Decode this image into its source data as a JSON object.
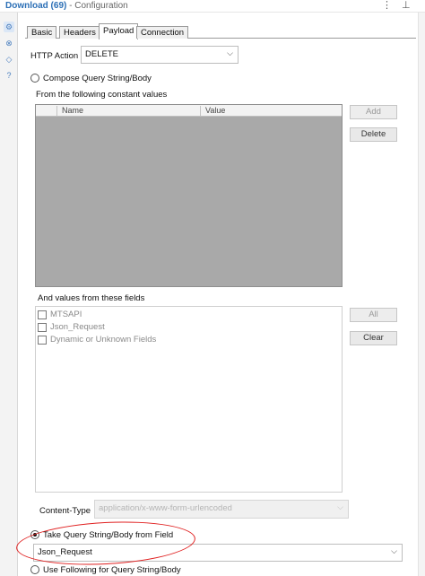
{
  "window": {
    "title": "Download (69)",
    "subtitle": "- Configuration"
  },
  "rail_icons": [
    "gear-icon",
    "close-circle-icon",
    "tag-icon",
    "help-icon"
  ],
  "tabs": [
    {
      "label": "Basic",
      "active": false
    },
    {
      "label": "Headers",
      "active": false
    },
    {
      "label": "Payload",
      "active": true
    },
    {
      "label": "Connection",
      "active": false
    }
  ],
  "http_action": {
    "label": "HTTP Action",
    "value": "DELETE"
  },
  "compose": {
    "radio_label": "Compose Query String/Body",
    "selected": false,
    "constants_label": "From the following constant values",
    "columns": [
      "Name",
      "Value"
    ],
    "buttons": {
      "add": "Add",
      "delete": "Delete"
    }
  },
  "fields": {
    "label": "And values from these fields",
    "items": [
      {
        "name": "MTSAPI",
        "checked": false
      },
      {
        "name": "Json_Request",
        "checked": false
      },
      {
        "name": "Dynamic or Unknown Fields",
        "checked": false
      }
    ],
    "buttons": {
      "all": "All",
      "clear": "Clear"
    }
  },
  "content_type": {
    "label": "Content-Type",
    "value": "application/x-www-form-urlencoded"
  },
  "take_field": {
    "radio_label": "Take Query String/Body from Field",
    "selected": true,
    "value": "Json_Request"
  },
  "use_following": {
    "radio_label": "Use Following for Query String/Body",
    "selected": false
  },
  "colors": {
    "accent": "#2b6fb6",
    "annotation": "#e02020",
    "grid_fill": "#a9a9a9"
  }
}
